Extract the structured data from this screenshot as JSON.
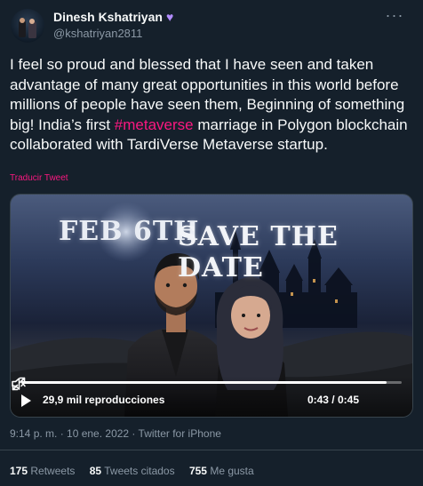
{
  "author": {
    "name": "Dinesh Kshatriyan",
    "heart": "♥",
    "handle": "@kshatriyan2811"
  },
  "tweet": {
    "text_before": "I feel so proud and blessed that I have seen and taken advantage of many great opportunities in this world before millions of people have seen them, Beginning of something big! India’s first ",
    "hashtag": "#metaverse",
    "text_after": " marriage in Polygon blockchain collaborated with TardiVerse Metaverse startup.",
    "translate_label": "Traducir Tweet"
  },
  "media": {
    "title_left": "FEB 6TH",
    "title_right": "SAVE THE DATE",
    "views": "29,9 mil reproducciones",
    "time": "0:43 / 0:45",
    "progress": 0.96
  },
  "meta": {
    "timestamp": "9:14 p. m. · 10 ene. 2022 · Twitter for iPhone"
  },
  "stats": [
    {
      "count": "175",
      "label": "Retweets"
    },
    {
      "count": "85",
      "label": "Tweets citados"
    },
    {
      "count": "755",
      "label": "Me gusta"
    }
  ],
  "colors": {
    "background": "#15202b",
    "accent_pink": "#f91880",
    "muted": "#8b98a5",
    "border": "#38444d"
  },
  "icons": [
    "more-icon",
    "verified-heart-icon",
    "play-icon",
    "mute-icon",
    "fullscreen-icon"
  ]
}
